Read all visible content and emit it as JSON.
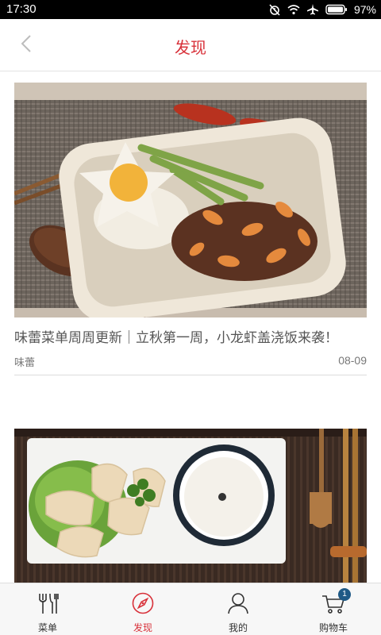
{
  "status_bar": {
    "time": "17:30",
    "battery_percent": "97%",
    "icons": [
      "alarm-off-icon",
      "wifi-icon",
      "airplane-mode-icon",
      "battery-icon"
    ]
  },
  "header": {
    "title": "发现",
    "back_icon": "chevron-left-icon",
    "accent_color": "#d8313a"
  },
  "feed": {
    "articles": [
      {
        "title": "味蕾菜单周周更新｜立秋第一周，小龙虾盖浇饭来袭！",
        "source": "味蕾",
        "date": "08-09",
        "image": "crayfish-rice-bowl-photo"
      },
      {
        "title": "",
        "source": "",
        "date": "",
        "image": "hainan-chicken-rice-photo"
      }
    ]
  },
  "tab_bar": {
    "active_tab": "discover",
    "tabs": [
      {
        "id": "menu",
        "label": "菜单",
        "icon": "utensils-icon"
      },
      {
        "id": "discover",
        "label": "发现",
        "icon": "compass-icon"
      },
      {
        "id": "mine",
        "label": "我的",
        "icon": "user-icon"
      },
      {
        "id": "cart",
        "label": "购物车",
        "icon": "cart-icon",
        "badge": "1"
      }
    ]
  }
}
